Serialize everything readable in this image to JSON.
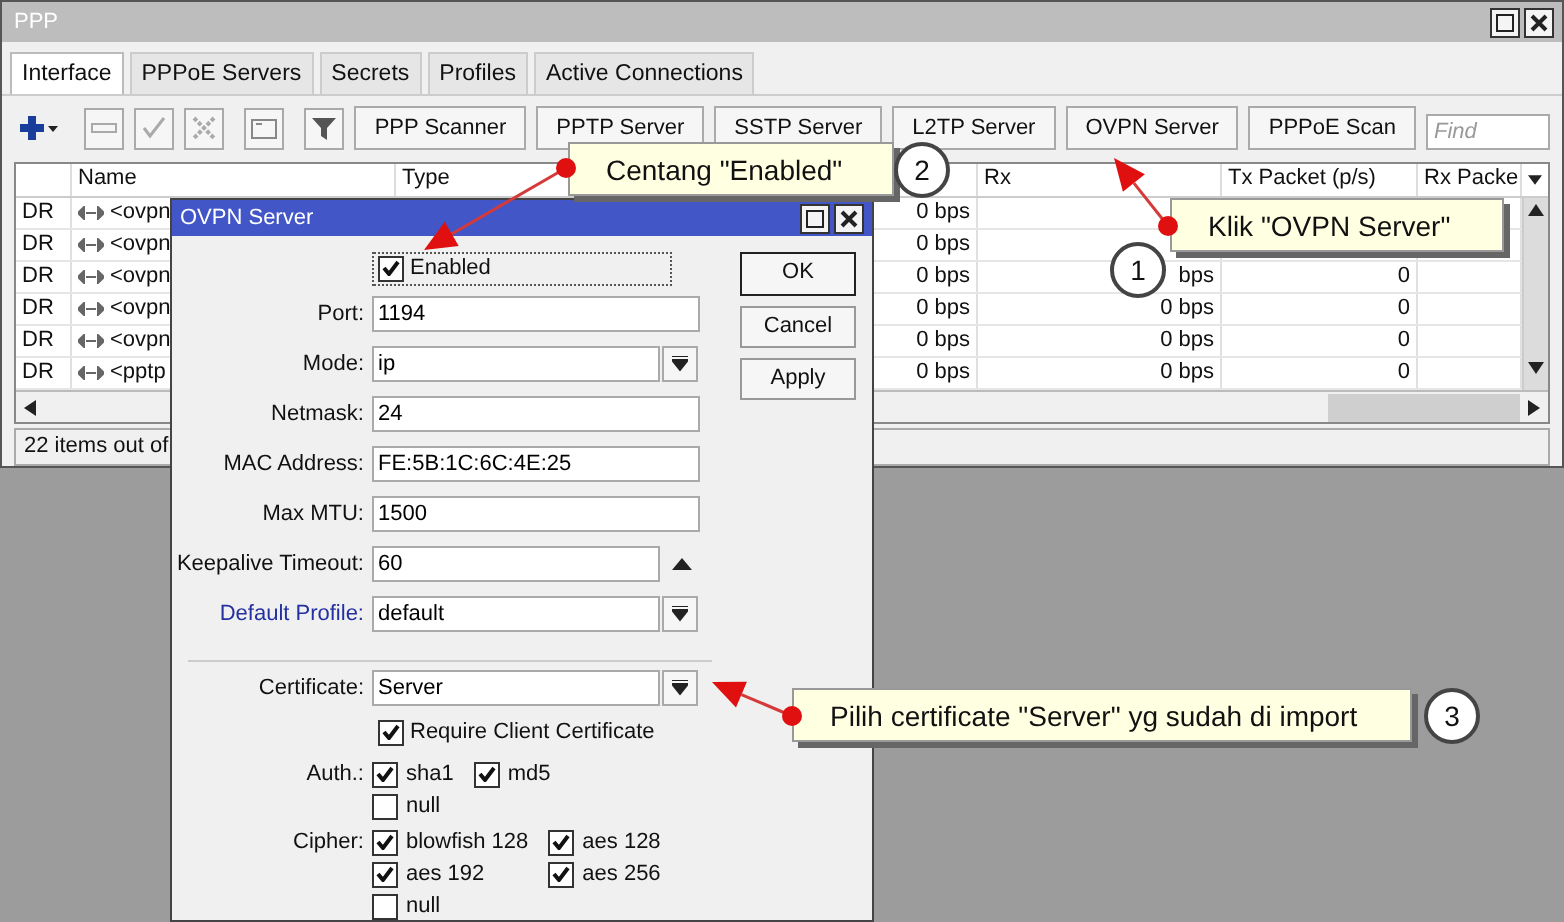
{
  "window": {
    "title": "PPP"
  },
  "tabs": [
    {
      "label": "Interface",
      "selected": true
    },
    {
      "label": "PPPoE Servers",
      "selected": false
    },
    {
      "label": "Secrets",
      "selected": false
    },
    {
      "label": "Profiles",
      "selected": false
    },
    {
      "label": "Active Connections",
      "selected": false
    }
  ],
  "toolbar": {
    "buttons": [
      "PPP Scanner",
      "PPTP Server",
      "SSTP Server",
      "L2TP Server",
      "OVPN Server",
      "PPPoE Scan"
    ],
    "find": {
      "placeholder": "Find"
    }
  },
  "table": {
    "columns": [
      {},
      {
        "label": "Name"
      },
      {
        "label": "Type"
      },
      {},
      {
        "label": "Rx"
      },
      {
        "label": "Tx Packet (p/s)"
      },
      {
        "label": "Rx Packe"
      }
    ],
    "rows": [
      {
        "cells": [
          "DR",
          "<ovpn",
          null,
          "0 bps",
          null,
          null,
          null
        ]
      },
      {
        "cells": [
          "DR",
          "<ovpn",
          null,
          "0 bps",
          null,
          null,
          null
        ]
      },
      {
        "cells": [
          "DR",
          "<ovpn",
          null,
          "0 bps",
          "bps",
          "0",
          null
        ]
      },
      {
        "cells": [
          "DR",
          "<ovpn",
          null,
          "0 bps",
          "0 bps",
          "0",
          null
        ]
      },
      {
        "cells": [
          "DR",
          "<ovpn",
          null,
          "0 bps",
          "0 bps",
          "0",
          null
        ]
      },
      {
        "cells": [
          "DR",
          "<pptp",
          null,
          "0 bps",
          "0 bps",
          "0",
          null
        ]
      }
    ],
    "status": "22 items out of"
  },
  "dialog": {
    "title": "OVPN Server",
    "fields": [
      {
        "kind": "checkbox",
        "label": "Enabled",
        "checked": true,
        "focused": true
      },
      {
        "kind": "text",
        "label": "Port:",
        "value": "1194"
      },
      {
        "kind": "select",
        "label": "Mode:",
        "value": "ip",
        "link": false
      },
      {
        "kind": "text",
        "label": "Netmask:",
        "value": "24"
      },
      {
        "kind": "text",
        "label": "MAC Address:",
        "value": "FE:5B:1C:6C:4E:25"
      },
      {
        "kind": "text",
        "label": "Max MTU:",
        "value": "1500"
      },
      {
        "kind": "spin",
        "label": "Keepalive Timeout:",
        "value": "60"
      },
      {
        "kind": "select",
        "label": "Default Profile:",
        "value": "default",
        "link": true
      },
      {
        "kind": "separator"
      },
      {
        "kind": "select",
        "label": "Certificate:",
        "value": "Server",
        "link": false
      },
      {
        "kind": "checkbox",
        "label": "Require Client Certificate",
        "checked": true,
        "focused": false
      },
      {
        "kind": "checks",
        "label": "Auth.:",
        "options": [
          {
            "label": "sha1",
            "checked": true
          },
          {
            "label": "md5",
            "checked": true
          },
          {
            "label": "null",
            "checked": false
          }
        ]
      },
      {
        "kind": "checks",
        "label": "Cipher:",
        "options": [
          {
            "label": "blowfish 128",
            "checked": true
          },
          {
            "label": "aes 128",
            "checked": true
          },
          {
            "label": "aes 192",
            "checked": true
          },
          {
            "label": "aes 256",
            "checked": true
          },
          {
            "label": "null",
            "checked": false
          }
        ]
      }
    ],
    "buttons": [
      {
        "label": "OK",
        "default": true
      },
      {
        "label": "Cancel",
        "default": false
      },
      {
        "label": "Apply",
        "default": false
      }
    ]
  },
  "annotations": [
    {
      "text": "Centang \"Enabled\"",
      "step": "2"
    },
    {
      "text": "Klik \"OVPN Server\"",
      "step": "1"
    },
    {
      "text": "Pilih certificate \"Server\" yg sudah di import",
      "step": "3"
    }
  ]
}
